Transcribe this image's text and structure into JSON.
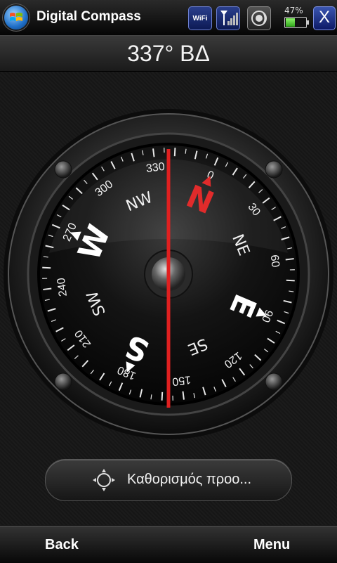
{
  "statusbar": {
    "app_title": "Digital Compass",
    "wifi_label": "WiFi",
    "battery_percent": "47%",
    "battery_level": 0.47,
    "close_label": "X"
  },
  "heading": {
    "text": "337° ΒΔ"
  },
  "compass": {
    "heading_degrees": 337,
    "cardinals": {
      "N": "N",
      "E": "E",
      "S": "S",
      "W": "W"
    },
    "intercardinals": {
      "NE": "NE",
      "SE": "SE",
      "SW": "SW",
      "NW": "NW"
    },
    "degree_labels": [
      "0",
      "30",
      "60",
      "90",
      "120",
      "150",
      "180",
      "210",
      "240",
      "270",
      "300",
      "330"
    ],
    "needle_color": "#e02020",
    "north_color": "#e02020"
  },
  "calibrate_button": {
    "label": "Καθορισμός προο..."
  },
  "softkeys": {
    "left": "Back",
    "right": "Menu"
  }
}
